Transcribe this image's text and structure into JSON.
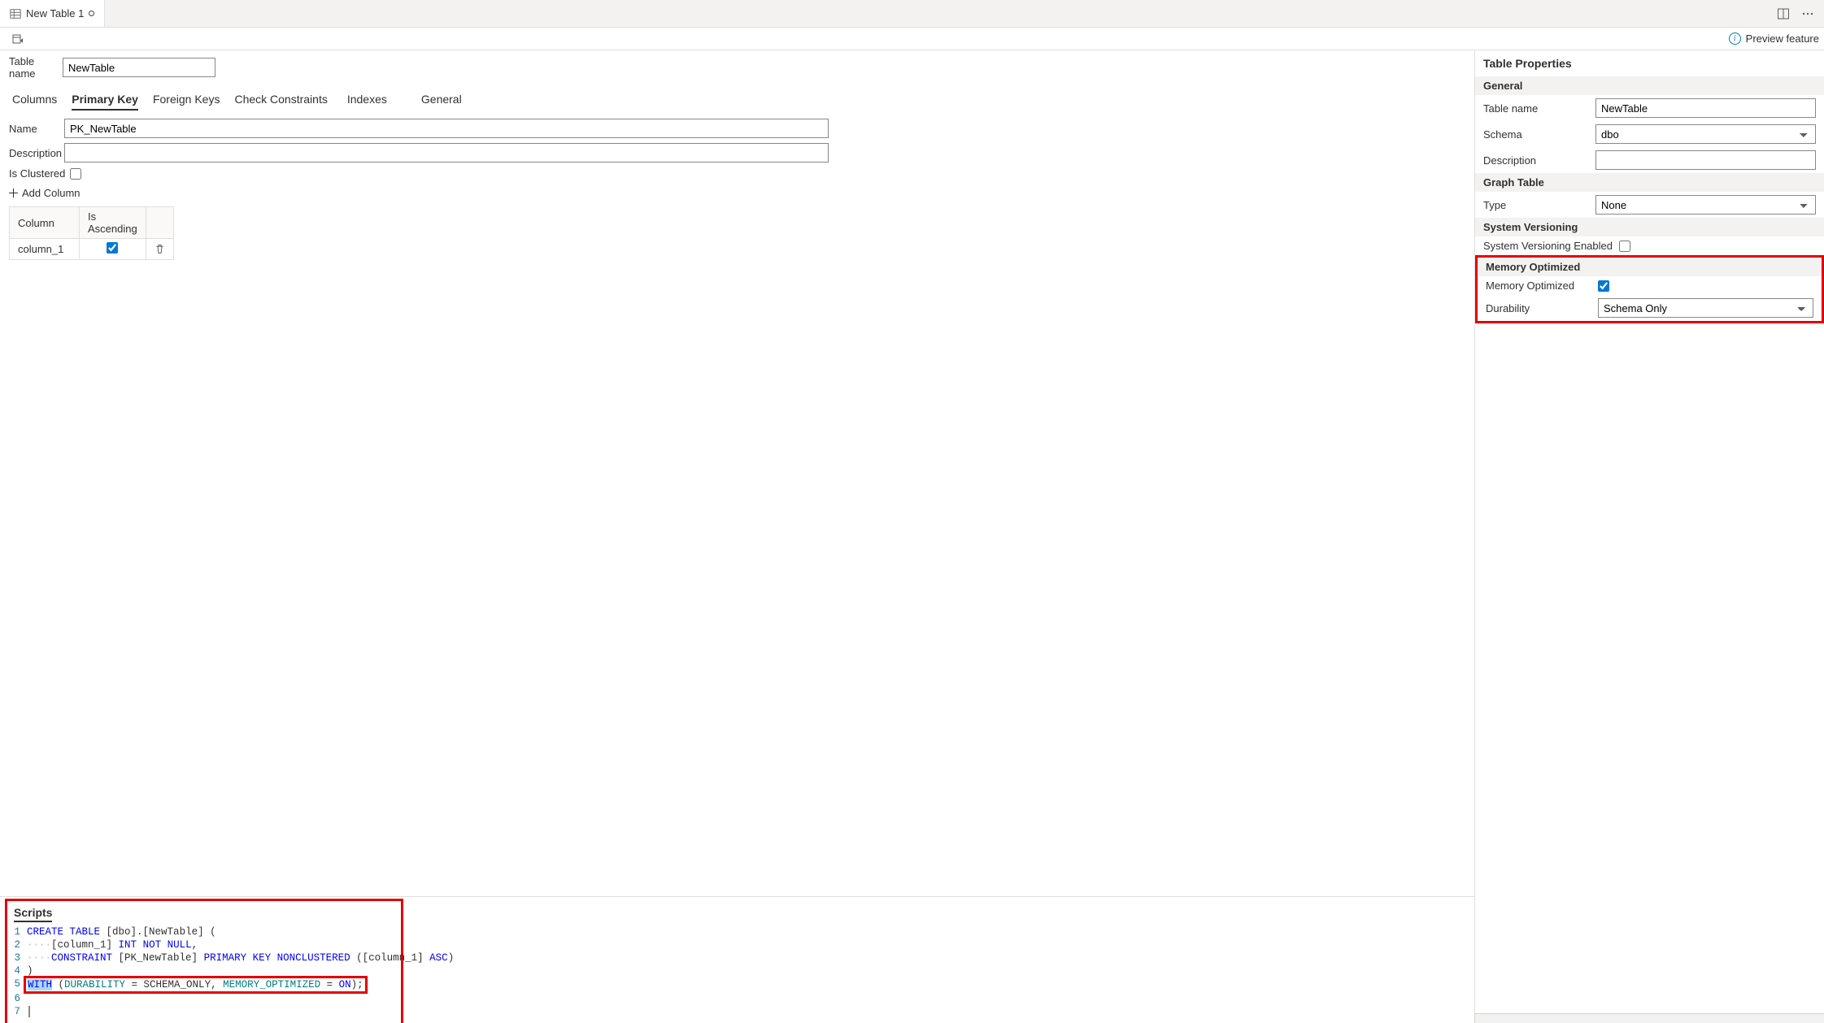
{
  "tabbar": {
    "tab_title": "New Table 1"
  },
  "toolbar": {
    "preview_label": "Preview feature"
  },
  "designer": {
    "table_name_label": "Table name",
    "table_name_value": "NewTable",
    "subtabs": {
      "columns": "Columns",
      "primary_key": "Primary Key",
      "foreign_keys": "Foreign Keys",
      "check_constraints": "Check Constraints",
      "indexes": "Indexes",
      "general": "General"
    },
    "pk_name_label": "Name",
    "pk_name_value": "PK_NewTable",
    "pk_desc_label": "Description",
    "pk_desc_value": "",
    "is_clustered_label": "Is Clustered",
    "is_clustered_checked": false,
    "add_column_label": "Add Column",
    "grid": {
      "col_header": "Column",
      "asc_header": "Is Ascending",
      "rows": [
        {
          "column": "column_1",
          "ascending": true
        }
      ]
    }
  },
  "scripts": {
    "title": "Scripts",
    "lines": [
      {
        "n": 1,
        "tokens": [
          {
            "t": "CREATE",
            "c": "kw"
          },
          {
            "t": " "
          },
          {
            "t": "TABLE",
            "c": "kw"
          },
          {
            "t": " [dbo].[NewTable] ("
          }
        ]
      },
      {
        "n": 2,
        "indent": true,
        "tokens": [
          {
            "t": "[column_1] "
          },
          {
            "t": "INT",
            "c": "kw"
          },
          {
            "t": " "
          },
          {
            "t": "NOT",
            "c": "kw"
          },
          {
            "t": " "
          },
          {
            "t": "NULL",
            "c": "kw"
          },
          {
            "t": ","
          }
        ]
      },
      {
        "n": 3,
        "indent": true,
        "tokens": [
          {
            "t": "CONSTRAINT",
            "c": "kw"
          },
          {
            "t": " [PK_NewTable] "
          },
          {
            "t": "PRIMARY",
            "c": "kw"
          },
          {
            "t": " "
          },
          {
            "t": "KEY",
            "c": "kw"
          },
          {
            "t": " "
          },
          {
            "t": "NONCLUSTERED",
            "c": "kw"
          },
          {
            "t": " ([column_1] "
          },
          {
            "t": "ASC",
            "c": "kw"
          },
          {
            "t": ")"
          }
        ]
      },
      {
        "n": 4,
        "tokens": [
          {
            "t": ")"
          }
        ]
      },
      {
        "n": 5,
        "hl": true,
        "tokens": [
          {
            "t": "WITH",
            "c": "kw",
            "sel": true
          },
          {
            "t": " ("
          },
          {
            "t": "DURABILITY",
            "c": "fn"
          },
          {
            "t": " = SCHEMA_ONLY, "
          },
          {
            "t": "MEMORY_OPTIMIZED",
            "c": "fn"
          },
          {
            "t": " = "
          },
          {
            "t": "ON",
            "c": "kw"
          },
          {
            "t": ");"
          }
        ]
      },
      {
        "n": 6,
        "tokens": []
      },
      {
        "n": 7,
        "tokens": [],
        "cursor": true
      }
    ]
  },
  "props": {
    "title": "Table Properties",
    "general_section": "General",
    "table_name_label": "Table name",
    "table_name_value": "NewTable",
    "schema_label": "Schema",
    "schema_value": "dbo",
    "description_label": "Description",
    "description_value": "",
    "graph_section": "Graph Table",
    "type_label": "Type",
    "type_value": "None",
    "sv_section": "System Versioning",
    "sv_enabled_label": "System Versioning Enabled",
    "sv_enabled_checked": false,
    "mo_section": "Memory Optimized",
    "mo_label": "Memory Optimized",
    "mo_checked": true,
    "durability_label": "Durability",
    "durability_value": "Schema Only"
  }
}
